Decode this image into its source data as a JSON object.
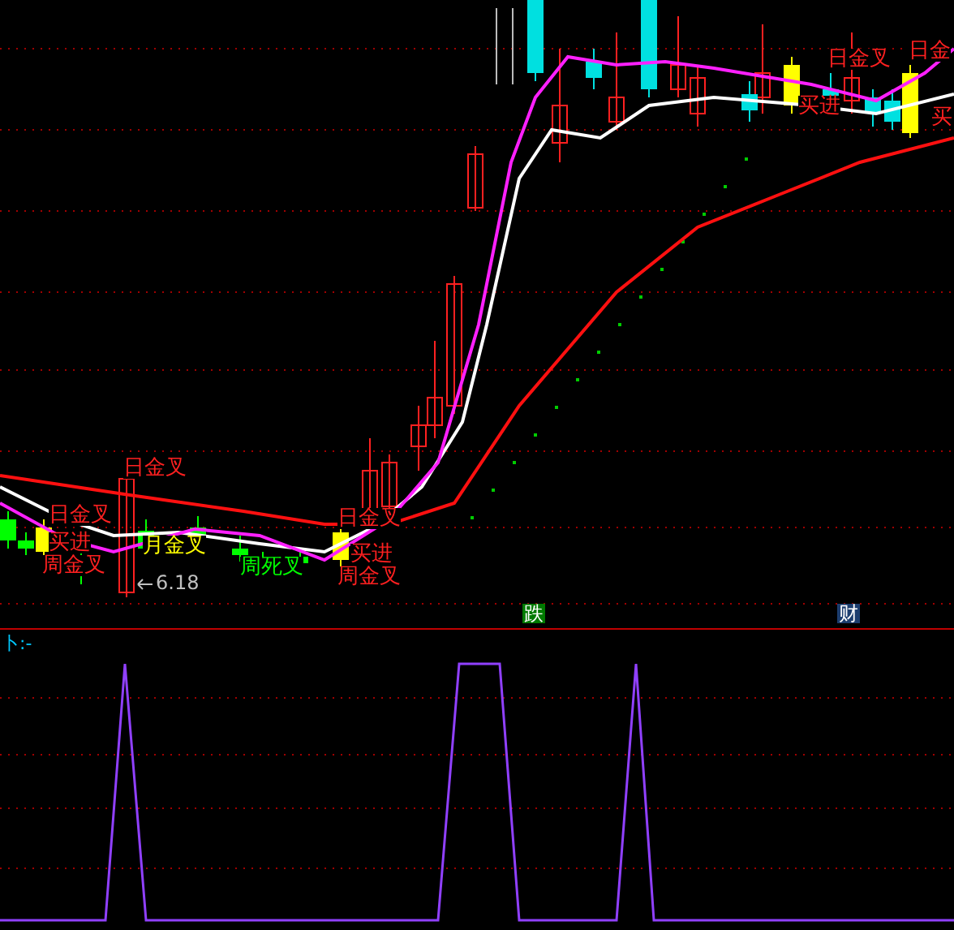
{
  "price_chart": {
    "labels": [
      {
        "text": "日金叉",
        "color": "#ff2020"
      },
      {
        "text": "日金叉",
        "color": "#ff2020"
      },
      {
        "text": "买进",
        "color": "#ff2020"
      },
      {
        "text": "周金叉",
        "color": "#ff2020"
      },
      {
        "text": "月金叉",
        "color": "#ffff00"
      },
      {
        "text": "周死叉",
        "color": "#00ff00"
      },
      {
        "text": "日金叉",
        "color": "#ff2020"
      },
      {
        "text": "买进",
        "color": "#ff2020"
      },
      {
        "text": "周金叉",
        "color": "#ff2020"
      },
      {
        "text": "日金叉",
        "color": "#ff2020"
      },
      {
        "text": "买进",
        "color": "#ff2020"
      },
      {
        "text": "日金",
        "color": "#ff2020"
      },
      {
        "text": "买",
        "color": "#ff2020"
      }
    ],
    "low_marker": "6.18",
    "badges": [
      {
        "text": "跌",
        "color": "#007a00"
      },
      {
        "text": "财",
        "color": "#1c3d6e"
      }
    ]
  },
  "indicator": {
    "title": "卜:-"
  }
}
